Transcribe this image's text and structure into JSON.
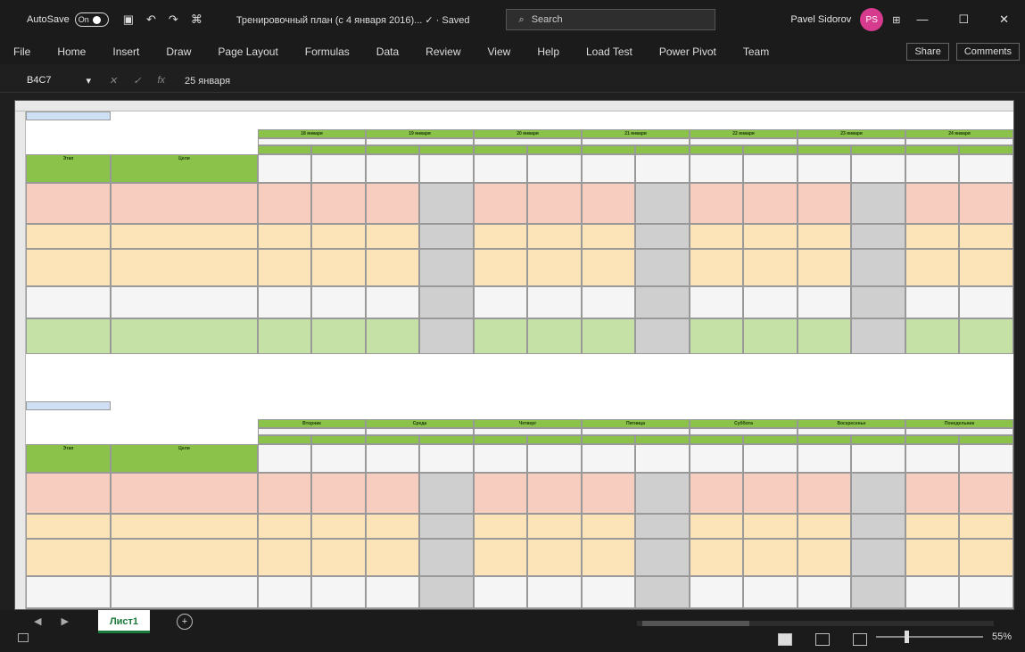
{
  "titlebar": {
    "autosave_label": "AutoSave",
    "toggle": "On",
    "doc_title": "Тренировочный план (с 4 января 2016)... ✓ · Saved",
    "search_placeholder": "Search",
    "user_name": "Pavel Sidorov",
    "user_initials": "PS"
  },
  "menu": {
    "tabs": [
      "File",
      "Home",
      "Insert",
      "Draw",
      "Page Layout",
      "Formulas",
      "Data",
      "Review",
      "View",
      "Help",
      "Load Test",
      "Power Pivot",
      "Team"
    ],
    "share": "Share",
    "comments": "Comments"
  },
  "formula": {
    "namebox": "B4C7",
    "value": "25 января"
  },
  "sheet": {
    "tab_name": "Лист1",
    "zoom": "55%"
  },
  "top": {
    "left_header": "Этап",
    "middle_header": "Цели",
    "dates": [
      "18 января",
      "19 января",
      "20 января",
      "21 января",
      "22 января",
      "23 января",
      "24 января"
    ]
  },
  "bottom": {
    "left_header": "Этап",
    "middle_header": "Цели",
    "days": [
      "Вторник",
      "Среда",
      "Четверг",
      "Пятница",
      "Суббота",
      "Воскресенье",
      "Понедельник"
    ]
  }
}
